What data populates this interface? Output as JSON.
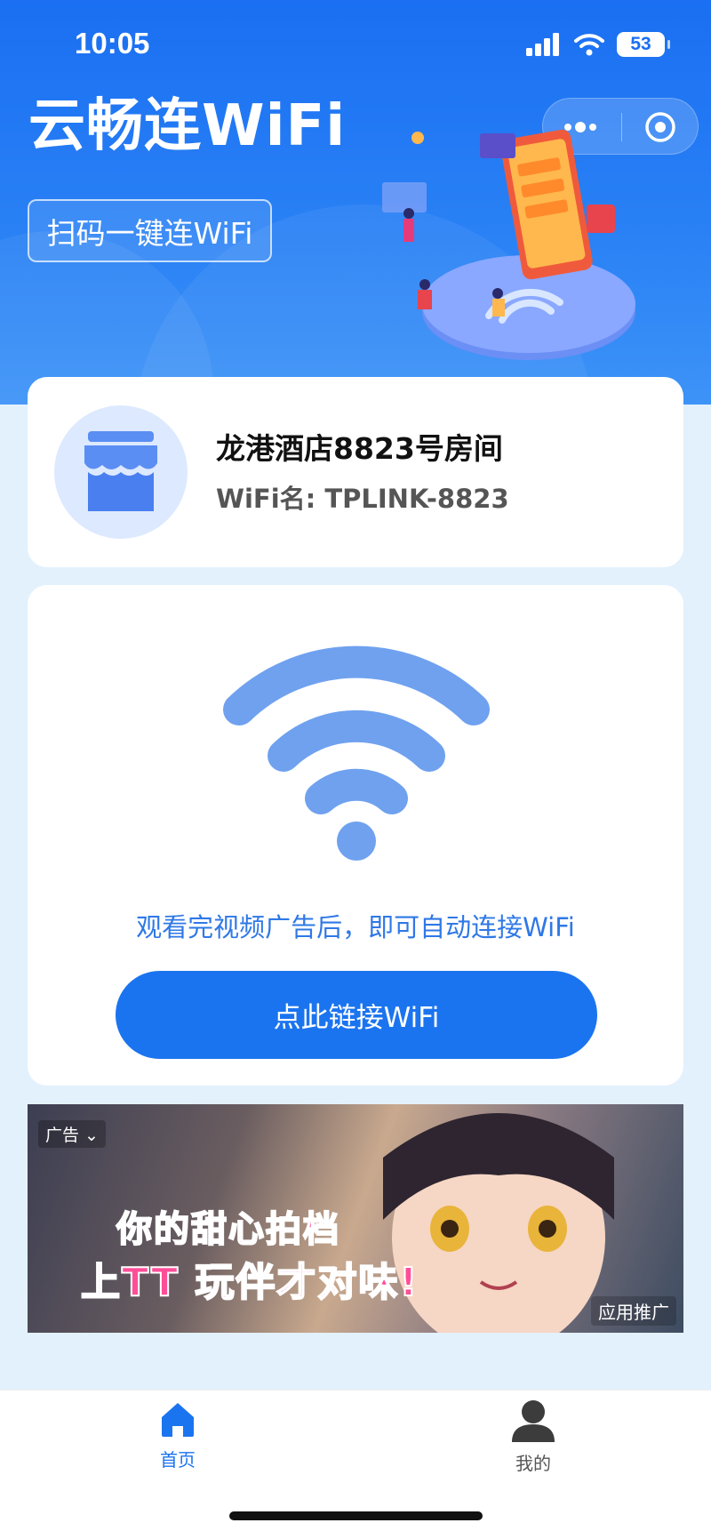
{
  "status_bar": {
    "time": "10:05",
    "battery": "53"
  },
  "header": {
    "app_title": "云畅连WiFi",
    "scan_button": "扫码一键连WiFi"
  },
  "hotel": {
    "name": "龙港酒店8823号房间",
    "wifi_label": "WiFi名: TPLINK-8823"
  },
  "connect": {
    "hint": "观看完视频广告后，即可自动连接WiFi",
    "button": "点此链接WiFi"
  },
  "ad": {
    "label": "广告",
    "line1": "你的甜心拍档",
    "line2": "上TT 玩伴才对味!",
    "tag": "应用推广"
  },
  "tabbar": {
    "items": [
      {
        "label": "首页",
        "icon": "home-icon",
        "active": true
      },
      {
        "label": "我的",
        "icon": "user-icon",
        "active": false
      }
    ]
  },
  "colors": {
    "primary": "#1b74ef",
    "header_bg": "#1a6ff2",
    "page_bg": "#e3f1fd",
    "wifi_icon": "#6fa1ef"
  }
}
